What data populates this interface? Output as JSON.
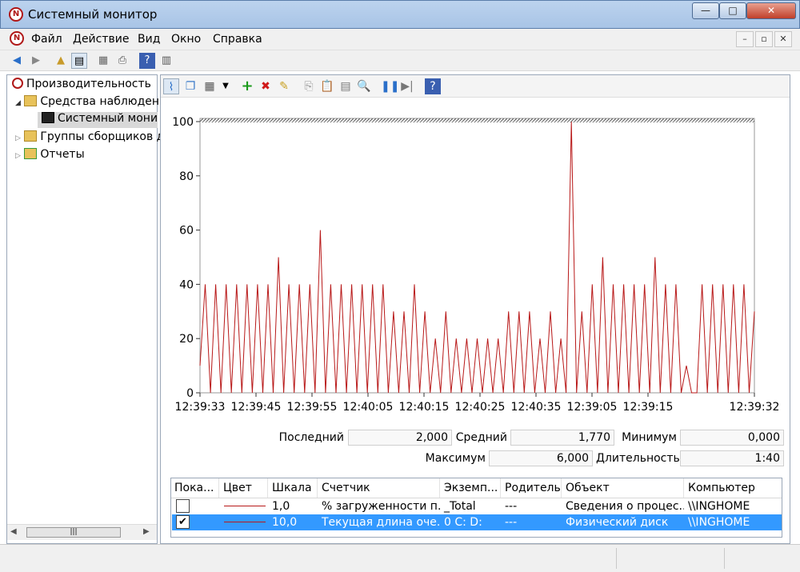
{
  "window": {
    "title": "Системный монитор",
    "minimize": "—",
    "maximize": "□",
    "close": "✕"
  },
  "menu": {
    "items": [
      "Файл",
      "Действие",
      "Вид",
      "Окно",
      "Справка"
    ],
    "mdi": [
      "–",
      "▫",
      "✕"
    ]
  },
  "tree": {
    "items": [
      "Производительность",
      "Средства наблюдени",
      "Системный монит",
      "Группы сборщиков д",
      "Отчеты"
    ]
  },
  "chart_data": {
    "type": "line",
    "ylim": [
      0,
      100
    ],
    "yticks": [
      0,
      20,
      40,
      60,
      80,
      100
    ],
    "xticks": [
      "12:39:33",
      "12:39:45",
      "12:39:55",
      "12:40:05",
      "12:40:15",
      "12:40:25",
      "12:40:35",
      "12:39:05",
      "12:39:15",
      "12:39:32"
    ],
    "series": [
      {
        "color": "#b81818",
        "values": [
          10,
          40,
          0,
          40,
          0,
          40,
          0,
          40,
          0,
          40,
          0,
          40,
          0,
          40,
          0,
          50,
          0,
          40,
          0,
          40,
          0,
          40,
          0,
          60,
          0,
          40,
          0,
          40,
          0,
          40,
          0,
          40,
          0,
          40,
          0,
          40,
          0,
          30,
          0,
          30,
          0,
          40,
          0,
          30,
          0,
          20,
          0,
          30,
          0,
          20,
          0,
          20,
          0,
          20,
          0,
          20,
          0,
          20,
          0,
          30,
          0,
          30,
          0,
          30,
          0,
          20,
          0,
          30,
          0,
          20,
          0,
          100,
          0,
          30,
          0,
          40,
          0,
          50,
          0,
          40,
          0,
          40,
          0,
          40,
          0,
          40,
          0,
          50,
          0,
          40,
          0,
          40,
          0,
          10,
          0,
          0,
          40,
          0,
          40,
          0,
          40,
          0,
          40,
          0,
          40,
          0,
          30
        ]
      }
    ]
  },
  "stats": {
    "last_label": "Последний",
    "last_value": "2,000",
    "avg_label": "Средний",
    "avg_value": "1,770",
    "min_label": "Минимум",
    "min_value": "0,000",
    "max_label": "Максимум",
    "max_value": "6,000",
    "dur_label": "Длительность",
    "dur_value": "1:40"
  },
  "table": {
    "headers": [
      "Пока...",
      "Цвет",
      "Шкала",
      "Счетчик",
      "Экземп...",
      "Родитель",
      "Объект",
      "Компьютер"
    ],
    "rows": [
      {
        "checked": "",
        "color": "#b81818",
        "scale": "1,0",
        "counter": "% загруженности п...",
        "instance": "_Total",
        "parent": "---",
        "object": "Сведения о процес...",
        "computer": "\\\\INGHOME"
      },
      {
        "checked": "✔",
        "color": "#b81818",
        "scale": "10,0",
        "counter": "Текущая длина оче...",
        "instance": "0 C: D:",
        "parent": "---",
        "object": "Физический диск",
        "computer": "\\\\INGHOME"
      }
    ]
  },
  "icons": {
    "app": "N"
  }
}
